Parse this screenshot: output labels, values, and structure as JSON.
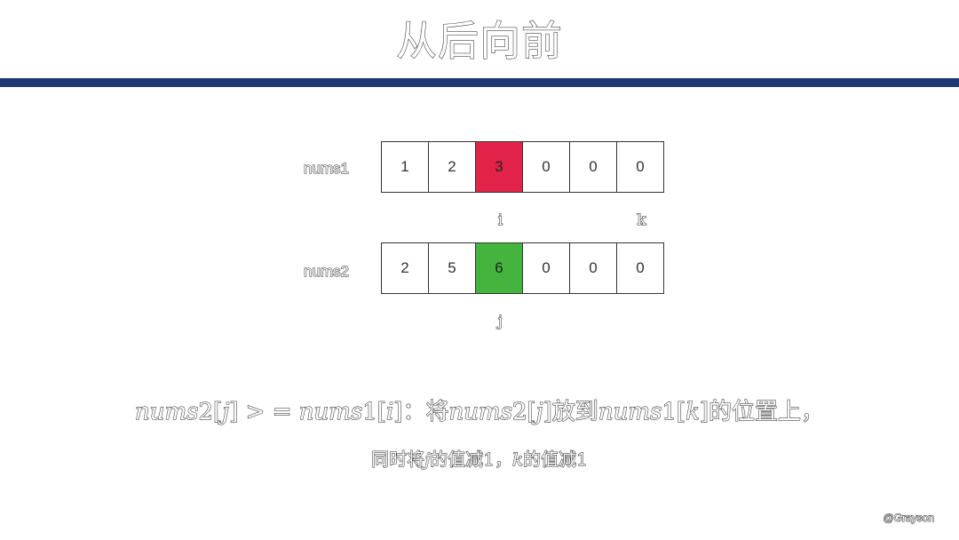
{
  "title": "从后向前",
  "arrays": [
    {
      "label": "nums1",
      "cells": [
        "1",
        "2",
        "3",
        "0",
        "0",
        "0"
      ],
      "highlight": {
        "index": 2,
        "color": "#e12447"
      }
    },
    {
      "label": "nums2",
      "cells": [
        "2",
        "5",
        "6",
        "0",
        "0",
        "0"
      ],
      "highlight": {
        "index": 2,
        "color": "#45b43e"
      }
    }
  ],
  "pointers": {
    "i": "i",
    "k": "k",
    "j": "j"
  },
  "formula": {
    "lhs_var": "nums",
    "lhs_num": "2[",
    "lhs_idx": "j",
    "lhs_close": "] > = ",
    "rhs_var": "nums",
    "rhs_num": "1[",
    "rhs_idx": "i",
    "rhs_close": "]",
    "sep": "：将",
    "src_var": "nums",
    "src_num": "2[",
    "src_idx": "j",
    "src_close": "]",
    "mid": "放到",
    "dst_var": "nums",
    "dst_num": "1[",
    "dst_idx": "k",
    "dst_close": "]",
    "tail": "的位置上，"
  },
  "note": {
    "part1": "同时将",
    "var_j": "j",
    "part2": "的值减1，",
    "var_k": "k",
    "part3": "的值减1"
  },
  "watermark": "@Grayson",
  "colors": {
    "title_bar": "#1f3a73",
    "highlight_red": "#e12447",
    "highlight_green": "#45b43e"
  }
}
